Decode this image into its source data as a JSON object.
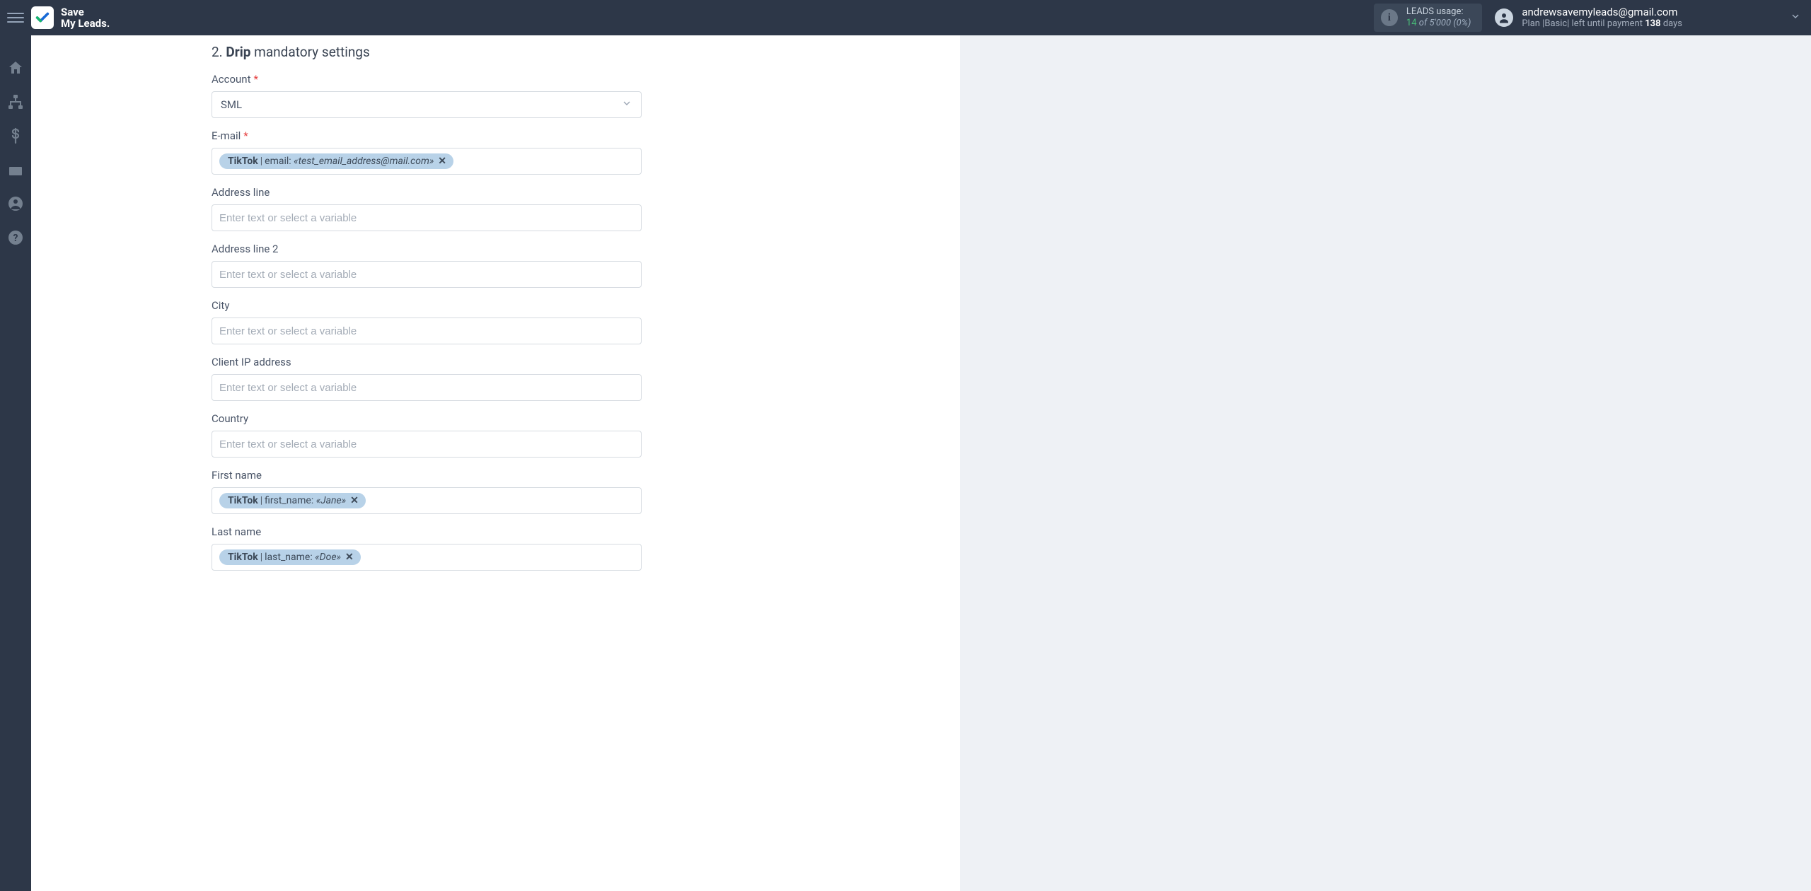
{
  "brand": {
    "line1": "Save",
    "line2": "My Leads",
    "dot": "."
  },
  "header": {
    "leads_label": "LEADS usage:",
    "leads_used": "14",
    "leads_of_word": "of",
    "leads_total": "5'000",
    "leads_pct": "(0%)",
    "user_email": "andrewsavemyleads@gmail.com",
    "plan_prefix": "Plan |",
    "plan_name": "Basic",
    "plan_mid": "| left until payment",
    "plan_days_num": "138",
    "plan_days_word": "days"
  },
  "section": {
    "num": "2.",
    "bold": "Drip",
    "rest": "mandatory settings"
  },
  "placeholders": {
    "variable": "Enter text or select a variable"
  },
  "fields": {
    "account": {
      "label": "Account",
      "required": true,
      "value": "SML"
    },
    "email": {
      "label": "E-mail",
      "required": true,
      "tag": {
        "source": "TikTok",
        "key": "email",
        "sample": "«test_email_address@mail.com»"
      }
    },
    "addr1": {
      "label": "Address line",
      "required": false
    },
    "addr2": {
      "label": "Address line 2",
      "required": false
    },
    "city": {
      "label": "City",
      "required": false
    },
    "ip": {
      "label": "Client IP address",
      "required": false
    },
    "country": {
      "label": "Country",
      "required": false
    },
    "first": {
      "label": "First name",
      "required": false,
      "tag": {
        "source": "TikTok",
        "key": "first_name",
        "sample": "«Jane»"
      }
    },
    "last": {
      "label": "Last name",
      "required": false,
      "tag": {
        "source": "TikTok",
        "key": "last_name",
        "sample": "«Doe»"
      }
    }
  }
}
